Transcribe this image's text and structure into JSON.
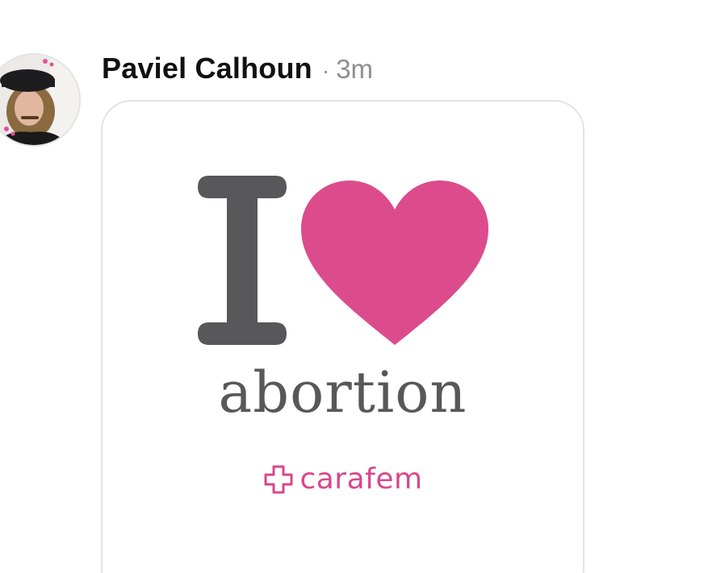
{
  "post": {
    "author": "Paviel Calhoun",
    "separator": "·",
    "time": "3m"
  },
  "media": {
    "headline_letter": "I",
    "headline_word": "abortion",
    "brand_name": "carafem",
    "brand_icon": "carafem-cross-icon",
    "heart_icon": "heart-icon",
    "colors": {
      "heart": "#dc4c8c",
      "text": "#58585a",
      "brand": "#d9478c"
    }
  }
}
